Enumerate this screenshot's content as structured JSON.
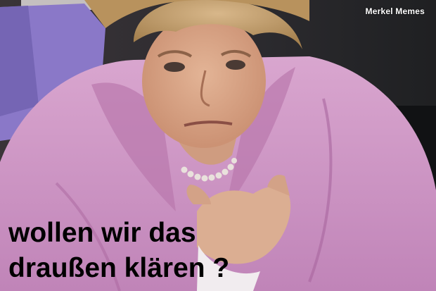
{
  "watermark": "Merkel Memes",
  "caption": {
    "line1": "wollen wir das",
    "line2": "draußen klären ?"
  },
  "colors": {
    "jacket": "#c98fc0",
    "seat": "#8a78c8",
    "caption_text": "#000000",
    "watermark_text": "#ffffff"
  }
}
